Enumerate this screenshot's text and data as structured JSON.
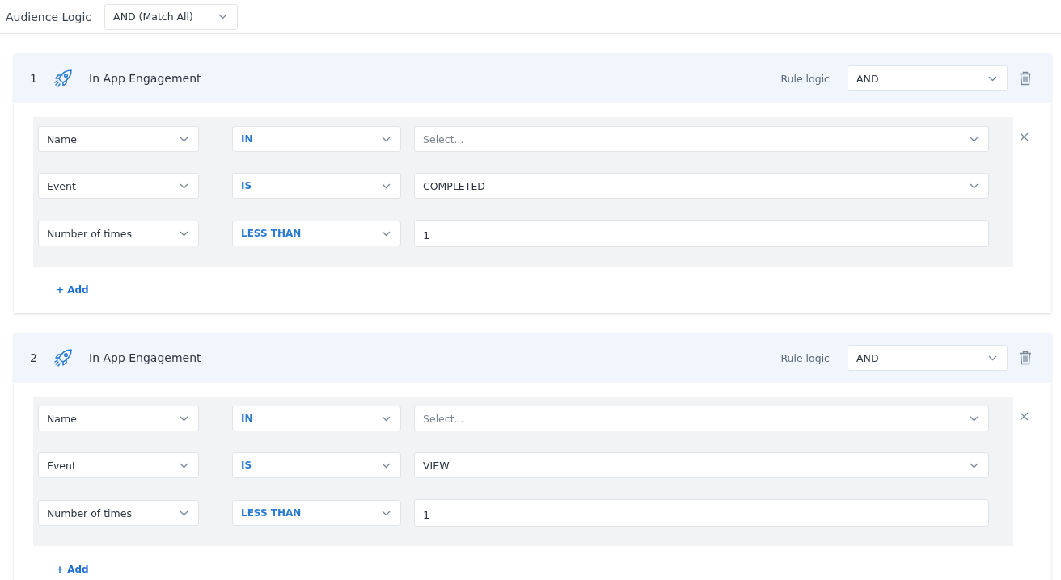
{
  "audience_logic": {
    "label": "Audience Logic",
    "value": "AND (Match All)"
  },
  "rules": [
    {
      "number": "1",
      "title": "In App Engagement",
      "rule_logic_label": "Rule logic",
      "rule_logic": "AND",
      "conditions": [
        {
          "field": "Name",
          "operator": "IN",
          "value": {
            "kind": "select",
            "placeholder": "Select..."
          }
        },
        {
          "field": "Event",
          "operator": "IS",
          "value": {
            "kind": "select",
            "value": "COMPLETED"
          }
        },
        {
          "field": "Number of times",
          "operator": "LESS THAN",
          "value": {
            "kind": "input",
            "value": "1"
          }
        }
      ],
      "add_label": "+ Add"
    },
    {
      "number": "2",
      "title": "In App Engagement",
      "rule_logic_label": "Rule logic",
      "rule_logic": "AND",
      "conditions": [
        {
          "field": "Name",
          "operator": "IN",
          "value": {
            "kind": "select",
            "placeholder": "Select..."
          }
        },
        {
          "field": "Event",
          "operator": "IS",
          "value": {
            "kind": "select",
            "value": "VIEW"
          }
        },
        {
          "field": "Number of times",
          "operator": "LESS THAN",
          "value": {
            "kind": "input",
            "value": "1"
          }
        }
      ],
      "add_label": "+ Add"
    }
  ]
}
